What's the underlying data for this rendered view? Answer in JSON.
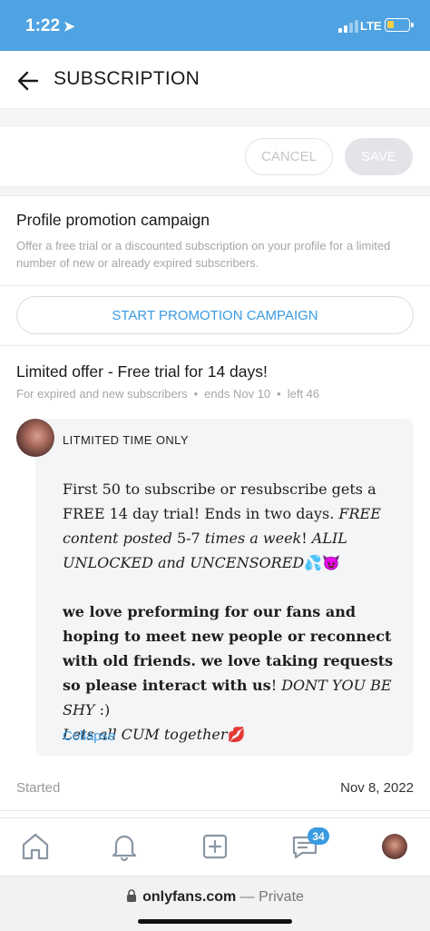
{
  "status_bar": {
    "time": "1:22",
    "location_arrow": "➤",
    "network": "LTE",
    "battery_level": 0.3,
    "battery_color": "#f7ce46"
  },
  "header": {
    "title": "SUBSCRIPTION",
    "back_icon": "arrow-left-icon"
  },
  "actions": {
    "cancel_label": "CANCEL",
    "save_label": "SAVE"
  },
  "promotion": {
    "title": "Profile promotion campaign",
    "description": "Offer a free trial or a discounted subscription on your profile for a limited number of new or already expired subscribers.",
    "start_label": "START PROMOTION CAMPAIGN"
  },
  "offer": {
    "title": "Limited offer - Free trial for 14 days!",
    "audience": "For expired and new subscribers",
    "ends": "ends Nov 10",
    "left": "left 46",
    "separator": "•",
    "post": {
      "heading": "LITMITED TIME ONLY",
      "line1_plain": "First 50 to subscribe or resubscribe gets a FREE 14 day trial! Ends in two days.",
      "line1_italic_a": "FREE content posted",
      "line1_plain_b": "5-7",
      "line1_italic_c": "times a week",
      "line1_plain_d": "!",
      "line1_italic_e": "ALIL UNLOCKED and UNCENSORED",
      "line1_emoji": "💦😈",
      "line2_bold_a": "we love preforming for our fans and hoping to meet new people or reconnect with old friends. we love taking requests so please interact with us",
      "line2_plain_b": "!",
      "line2_italic_c": "DONT YOU BE SHY",
      "line2_plain_d": ":)",
      "line3_italic": "Lets all CUM together",
      "line3_emoji": "💋",
      "collapse_label": "Collapse"
    },
    "started_label": "Started",
    "started_date": "Nov 8, 2022"
  },
  "tabbar": {
    "items": [
      "home-icon",
      "bell-icon",
      "plus-square-icon",
      "message-icon",
      "profile-avatar"
    ],
    "messages_badge": "34",
    "accent": "#3a9be0"
  },
  "browser": {
    "domain": "onlyfans.com",
    "separator": "—",
    "mode": "Private"
  }
}
